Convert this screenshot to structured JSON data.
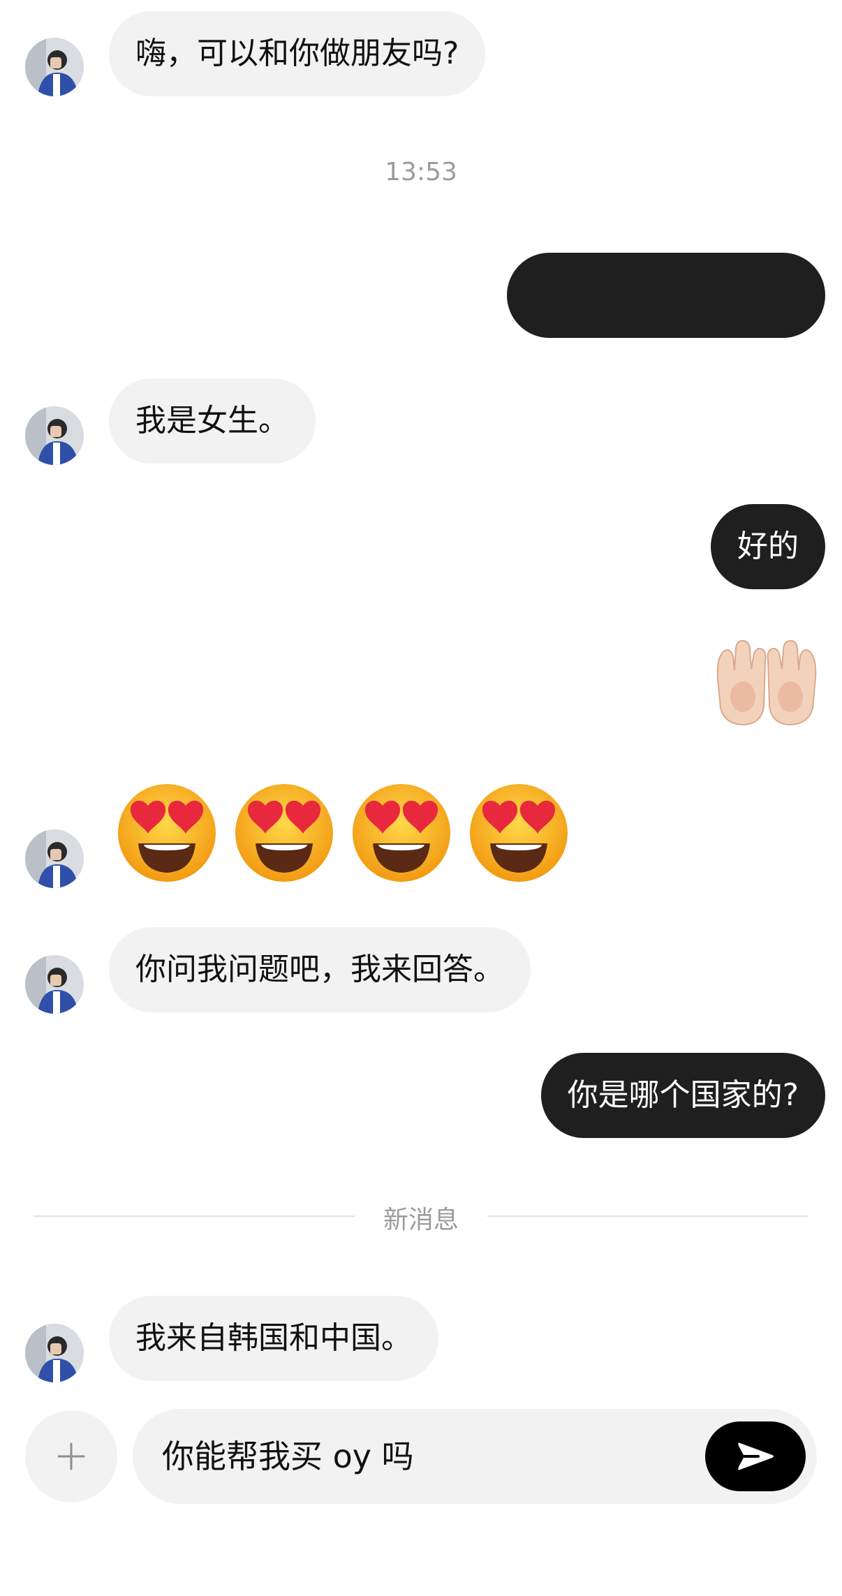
{
  "timestamp": "13:53",
  "messages": {
    "m1": "嗨，可以和你做朋友吗?",
    "m2": "",
    "m3": "我是女生。",
    "m4": "好的",
    "m5": "你问我问题吧，我来回答。",
    "m6": "你是哪个国家的?",
    "m7": "我来自韩国和中国。"
  },
  "emoji": {
    "hands": "palms-up-together-emoji",
    "faces": [
      "heart-eyes-emoji",
      "heart-eyes-emoji",
      "heart-eyes-emoji",
      "heart-eyes-emoji"
    ]
  },
  "divider": {
    "label": "新消息"
  },
  "composer": {
    "value": "你能帮我买 oy 吗",
    "add_icon": "plus-icon",
    "send_icon": "send-arrow-icon"
  },
  "colors": {
    "incoming_bubble": "#f2f2f2",
    "outgoing_bubble": "#1f1f1f",
    "send_button": "#000000",
    "muted_text": "#9b9b9b"
  }
}
